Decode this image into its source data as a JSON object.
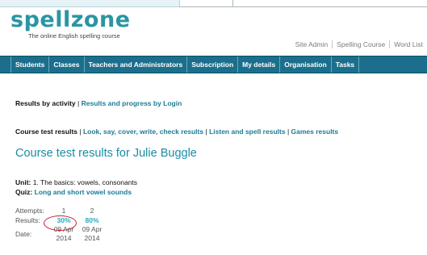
{
  "logo": {
    "word": "spellzone",
    "tagline": "The online English spelling course"
  },
  "util_nav": [
    "Site Admin",
    "Spelling Course",
    "Word List"
  ],
  "main_nav": [
    "Students",
    "Classes",
    "Teachers and Administrators",
    "Subscription",
    "My details",
    "Organisation",
    "Tasks"
  ],
  "view_switch": {
    "current": "Results by activity",
    "separator": "|",
    "link": "Results and progress by Login"
  },
  "result_types": {
    "current": "Course test results",
    "links": [
      "Look, say, cover, write, check results",
      "Listen and spell results",
      "Games results"
    ]
  },
  "page_title": "Course test results for Julie Buggle",
  "unit": {
    "label": "Unit:",
    "value": "1. The basics: vowels, consonants"
  },
  "quiz": {
    "label": "Quiz:",
    "value": "Long and short vowel sounds"
  },
  "attempts_table": {
    "labels": {
      "attempts": "Attempts:",
      "results": "Results:",
      "date": "Date:"
    },
    "columns": [
      {
        "attempt": "1",
        "result": "30%",
        "date_line1": "09 Apr",
        "date_line2": "2014"
      },
      {
        "attempt": "2",
        "result": "80%",
        "date_line1": "09 Apr",
        "date_line2": "2014"
      }
    ]
  },
  "colors": {
    "nav_bg": "#1b6f8c",
    "link": "#1a7c97",
    "title": "#1a8ca4",
    "highlight_circle": "#c8202b"
  }
}
